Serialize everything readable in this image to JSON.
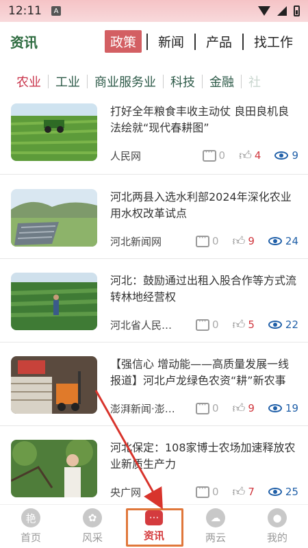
{
  "status_bar": {
    "time": "12:11",
    "notice_letter": "A"
  },
  "header": {
    "title": "资讯",
    "tabs": [
      {
        "label": "政策",
        "active": true
      },
      {
        "label": "新闻",
        "active": false
      },
      {
        "label": "产品",
        "active": false
      },
      {
        "label": "找工作",
        "active": false
      }
    ]
  },
  "categories": [
    "农业",
    "工业",
    "商业服务业",
    "科技",
    "金融",
    "社"
  ],
  "news": [
    {
      "title": "打好全年粮食丰收主动仗 良田良机良法绘就“现代春耕图”",
      "source": "人民网",
      "comments": "0",
      "likes": "4",
      "views": "9",
      "thumb": "tractor-field"
    },
    {
      "title": "河北两县入选水利部2024年深化农业用水权改革试点",
      "source": "河北新闻网",
      "comments": "0",
      "likes": "9",
      "views": "24",
      "thumb": "greenhouse-valley"
    },
    {
      "title": "河北：鼓励通过出租入股合作等方式流转林地经营权",
      "source": "河北省人民政府",
      "comments": "0",
      "likes": "5",
      "views": "22",
      "thumb": "forest-worker"
    },
    {
      "title": "【强信心 增动能——高质量发展一线报道】河北卢龙绿色农资“耕”新农事",
      "source": "澎湃新闻·澎湃号",
      "comments": "0",
      "likes": "9",
      "views": "19",
      "thumb": "warehouse-forklift"
    },
    {
      "title": "河北保定：108家博士农场加速释放农业新质生产力",
      "source": "央广网",
      "comments": "0",
      "likes": "7",
      "views": "25",
      "thumb": "orchard-farmer"
    }
  ],
  "bottom_nav": [
    {
      "label": "首页",
      "icon": "home-icon",
      "active": false
    },
    {
      "label": "风采",
      "icon": "flower-icon",
      "active": false
    },
    {
      "label": "资讯",
      "icon": "chat-icon",
      "active": true
    },
    {
      "label": "两云",
      "icon": "cloud-icon",
      "active": false
    },
    {
      "label": "我的",
      "icon": "person-icon",
      "active": false
    }
  ],
  "colors": {
    "accent_red": "#d35f63",
    "nav_active": "#d43b3e",
    "title_green": "#2d6b3f",
    "annotation": "#e0773a"
  }
}
